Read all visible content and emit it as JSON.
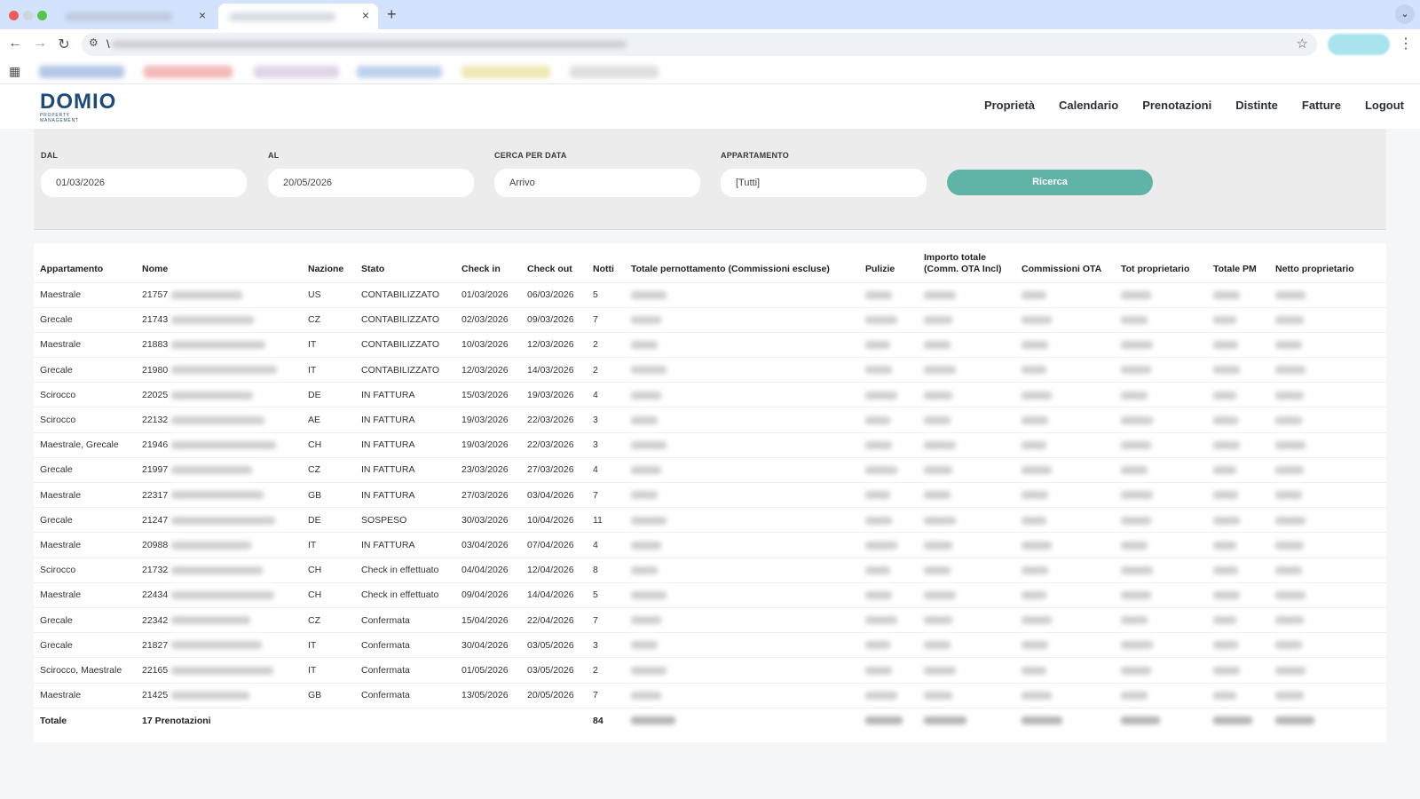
{
  "browser": {
    "tab_close_glyph": "×",
    "new_tab_glyph": "+",
    "address_prefix": "\\"
  },
  "logo": {
    "word": "DOMIO",
    "sub": "PROPERTY MANAGEMENT"
  },
  "nav": [
    "Proprietà",
    "Calendario",
    "Prenotazioni",
    "Distinte",
    "Fatture",
    "Logout"
  ],
  "filters": {
    "dal": {
      "label": "DAL",
      "value": "01/03/2026"
    },
    "al": {
      "label": "AL",
      "value": "20/05/2026"
    },
    "cerca": {
      "label": "CERCA PER DATA",
      "value": "Arrivo"
    },
    "appartamento": {
      "label": "APPARTAMENTO",
      "value": "[Tutti]"
    },
    "search_button": "Ricerca"
  },
  "table": {
    "headers": {
      "appartamento": "Appartamento",
      "nome": "Nome",
      "nazione": "Nazione",
      "stato": "Stato",
      "checkin": "Check in",
      "checkout": "Check out",
      "notti": "Notti",
      "totale_pern": "Totale pernottamento (Commissioni escluse)",
      "pulizie": "Pulizie",
      "importo_1": "Importo totale",
      "importo_2": "(Comm. OTA Incl)",
      "commissioni": "Commissioni OTA",
      "tot_prop": "Tot proprietario",
      "totale_pm": "Totale PM",
      "netto": "Netto proprietario"
    },
    "rows": [
      {
        "app": "Maestrale",
        "id": "21757",
        "naz": "US",
        "stato": "CONTABILIZZATO",
        "in": "01/03/2026",
        "out": "06/03/2026",
        "notti": "5"
      },
      {
        "app": "Grecale",
        "id": "21743",
        "naz": "CZ",
        "stato": "CONTABILIZZATO",
        "in": "02/03/2026",
        "out": "09/03/2026",
        "notti": "7"
      },
      {
        "app": "Maestrale",
        "id": "21883",
        "naz": "IT",
        "stato": "CONTABILIZZATO",
        "in": "10/03/2026",
        "out": "12/03/2026",
        "notti": "2"
      },
      {
        "app": "Grecale",
        "id": "21980",
        "naz": "IT",
        "stato": "CONTABILIZZATO",
        "in": "12/03/2026",
        "out": "14/03/2026",
        "notti": "2"
      },
      {
        "app": "Scirocco",
        "id": "22025",
        "naz": "DE",
        "stato": "IN FATTURA",
        "in": "15/03/2026",
        "out": "19/03/2026",
        "notti": "4"
      },
      {
        "app": "Scirocco",
        "id": "22132",
        "naz": "AE",
        "stato": "IN FATTURA",
        "in": "19/03/2026",
        "out": "22/03/2026",
        "notti": "3"
      },
      {
        "app": "Maestrale, Grecale",
        "id": "21946",
        "naz": "CH",
        "stato": "IN FATTURA",
        "in": "19/03/2026",
        "out": "22/03/2026",
        "notti": "3"
      },
      {
        "app": "Grecale",
        "id": "21997",
        "naz": "CZ",
        "stato": "IN FATTURA",
        "in": "23/03/2026",
        "out": "27/03/2026",
        "notti": "4"
      },
      {
        "app": "Maestrale",
        "id": "22317",
        "naz": "GB",
        "stato": "IN FATTURA",
        "in": "27/03/2026",
        "out": "03/04/2026",
        "notti": "7"
      },
      {
        "app": "Grecale",
        "id": "21247",
        "naz": "DE",
        "stato": "SOSPESO",
        "in": "30/03/2026",
        "out": "10/04/2026",
        "notti": "11"
      },
      {
        "app": "Maestrale",
        "id": "20988",
        "naz": "IT",
        "stato": "IN FATTURA",
        "in": "03/04/2026",
        "out": "07/04/2026",
        "notti": "4"
      },
      {
        "app": "Scirocco",
        "id": "21732",
        "naz": "CH",
        "stato": "Check in effettuato",
        "in": "04/04/2026",
        "out": "12/04/2026",
        "notti": "8"
      },
      {
        "app": "Maestrale",
        "id": "22434",
        "naz": "CH",
        "stato": "Check in effettuato",
        "in": "09/04/2026",
        "out": "14/04/2026",
        "notti": "5"
      },
      {
        "app": "Grecale",
        "id": "22342",
        "naz": "CZ",
        "stato": "Confermata",
        "in": "15/04/2026",
        "out": "22/04/2026",
        "notti": "7"
      },
      {
        "app": "Grecale",
        "id": "21827",
        "naz": "IT",
        "stato": "Confermata",
        "in": "30/04/2026",
        "out": "03/05/2026",
        "notti": "3"
      },
      {
        "app": "Scirocco, Maestrale",
        "id": "22165",
        "naz": "IT",
        "stato": "Confermata",
        "in": "01/05/2026",
        "out": "03/05/2026",
        "notti": "2"
      },
      {
        "app": "Maestrale",
        "id": "21425",
        "naz": "GB",
        "stato": "Confermata",
        "in": "13/05/2026",
        "out": "20/05/2026",
        "notti": "7"
      }
    ],
    "total": {
      "label": "Totale",
      "count": "17 Prenotazioni",
      "notti": "84"
    }
  }
}
